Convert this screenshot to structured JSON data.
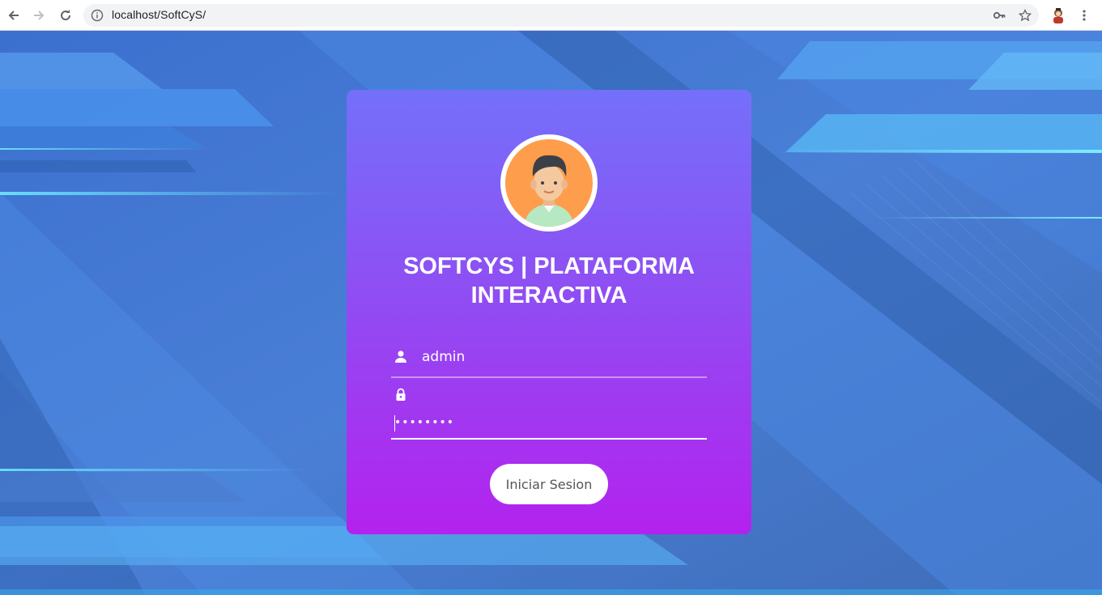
{
  "browser": {
    "url": "localhost/SoftCyS/",
    "icons": [
      "back-arrow-icon",
      "forward-arrow-icon",
      "reload-icon",
      "info-icon",
      "key-icon",
      "star-icon",
      "profile-avatar-icon",
      "menu-dots-icon"
    ]
  },
  "login": {
    "title_line1": "SOFTCYS | PLATAFORMA",
    "title_line2": "INTERACTIVA",
    "username_value": "admin",
    "password_value": "••••••••",
    "submit_label": "Iniciar Sesion",
    "icons": [
      "user-icon",
      "lock-icon",
      "user-avatar-icon"
    ]
  },
  "colors": {
    "card_top": "#7470fa",
    "card_bottom": "#b322ee",
    "background": "#3a6fc4",
    "avatar_bg": "#fe9d4b"
  }
}
